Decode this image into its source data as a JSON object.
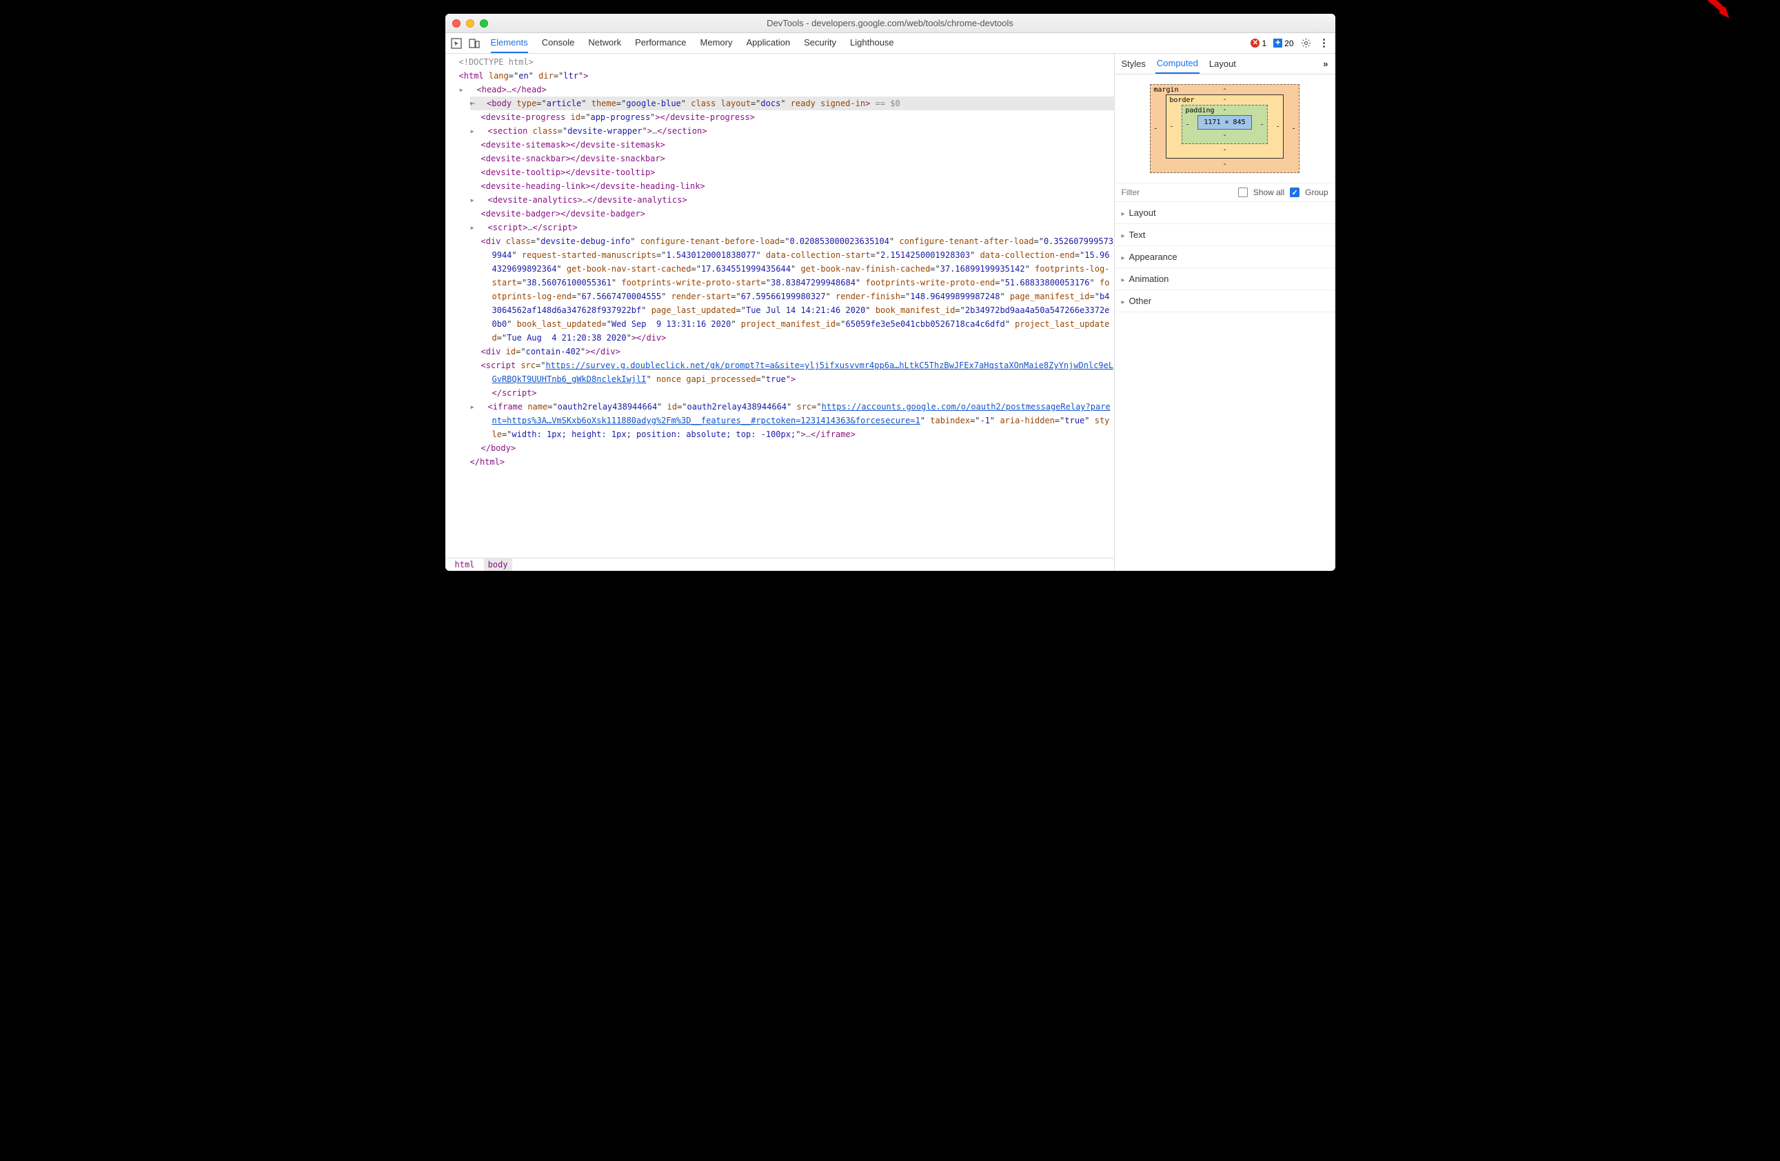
{
  "window": {
    "title": "DevTools - developers.google.com/web/tools/chrome-devtools"
  },
  "tabs": [
    "Elements",
    "Console",
    "Network",
    "Performance",
    "Memory",
    "Application",
    "Security",
    "Lighthouse"
  ],
  "active_tab": "Elements",
  "errors": {
    "error_count": "1",
    "message_count": "20"
  },
  "dom": {
    "doctype": "<!DOCTYPE html>",
    "html_open": {
      "lang": "en",
      "dir": "ltr"
    },
    "head": "<head>…</head>",
    "body_open": {
      "type": "article",
      "theme": "google-blue",
      "layout": "docs",
      "ready": "ready",
      "signed": "signed-in",
      "eq": "== $0"
    },
    "progress": {
      "id": "app-progress"
    },
    "section": {
      "class": "devsite-wrapper"
    },
    "sitemask": "devsite-sitemask",
    "snackbar": "devsite-snackbar",
    "tooltip": "devsite-tooltip",
    "heading": "devsite-heading-link",
    "analytics": "devsite-analytics",
    "badger": "devsite-badger",
    "script1": "script",
    "div_debug": {
      "class": "devsite-debug-info",
      "attrs": [
        [
          "configure-tenant-before-load",
          "0.020853000023635104"
        ],
        [
          "configure-tenant-after-load",
          "0.3526079995739944"
        ],
        [
          "request-started-manuscripts",
          "1.5430120001838077"
        ],
        [
          "data-collection-start",
          "2.1514250001928303"
        ],
        [
          "data-collection-end",
          "15.964329699892364"
        ],
        [
          "get-book-nav-start-cached",
          "17.634551999435644"
        ],
        [
          "get-book-nav-finish-cached",
          "37.16899199935142"
        ],
        [
          "footprints-log-start",
          "38.56076100055361"
        ],
        [
          "footprints-write-proto-start",
          "38.83847299948684"
        ],
        [
          "footprints-write-proto-end",
          "51.68833800053176"
        ],
        [
          "footprints-log-end",
          "67.5667470004555"
        ],
        [
          "render-start",
          "67.59566199980327"
        ],
        [
          "render-finish",
          "148.96499899987248"
        ],
        [
          "page_manifest_id",
          "b43064562af148d6a347628f937922bf"
        ],
        [
          "page_last_updated",
          "Tue Jul 14 14:21:46 2020"
        ],
        [
          "book_manifest_id",
          "2b34972bd9aa4a50a547266e3372e0b0"
        ],
        [
          "book_last_updated",
          "Wed Sep  9 13:31:16 2020"
        ],
        [
          "project_manifest_id",
          "65059fe3e5e041cbb0526718ca4c6dfd"
        ],
        [
          "project_last_updated",
          "Tue Aug  4 21:20:38 2020"
        ]
      ]
    },
    "contain": {
      "id": "contain-402"
    },
    "survey": {
      "src": "https://survey.g.doubleclick.net/gk/prompt?t=a&site=ylj5ifxusvvmr4pp6a…hLtkC5ThzBwJFEx7aHqstaXOnMaie8ZyYnjwDnlc9eLGvRBQkT9UUHTnb6_gWkD8nclekIwjlI",
      "nonce": "nonce",
      "gapi": "true"
    },
    "iframe": {
      "name": "oauth2relay438944664",
      "id": "oauth2relay438944664",
      "src": "https://accounts.google.com/o/oauth2/postmessageRelay?parent=https%3A…VmSKxb6oXsk111880adyg%2Fm%3D__features__#rpctoken=1231414363&forcesecure=1",
      "tabindex": "-1",
      "aria_hidden": "true",
      "style": "width: 1px; height: 1px; position: absolute; top: -100px;"
    }
  },
  "breadcrumbs": [
    "html",
    "body"
  ],
  "sidebar": {
    "tabs": [
      "Styles",
      "Computed",
      "Layout"
    ],
    "active": "Computed",
    "box": {
      "margin": "margin",
      "border": "border",
      "padding": "padding",
      "dash": "-",
      "content": "1171 × 845"
    },
    "filter": {
      "placeholder": "Filter",
      "show_all": "Show all",
      "group": "Group"
    },
    "sections": [
      "Layout",
      "Text",
      "Appearance",
      "Animation",
      "Other"
    ]
  }
}
